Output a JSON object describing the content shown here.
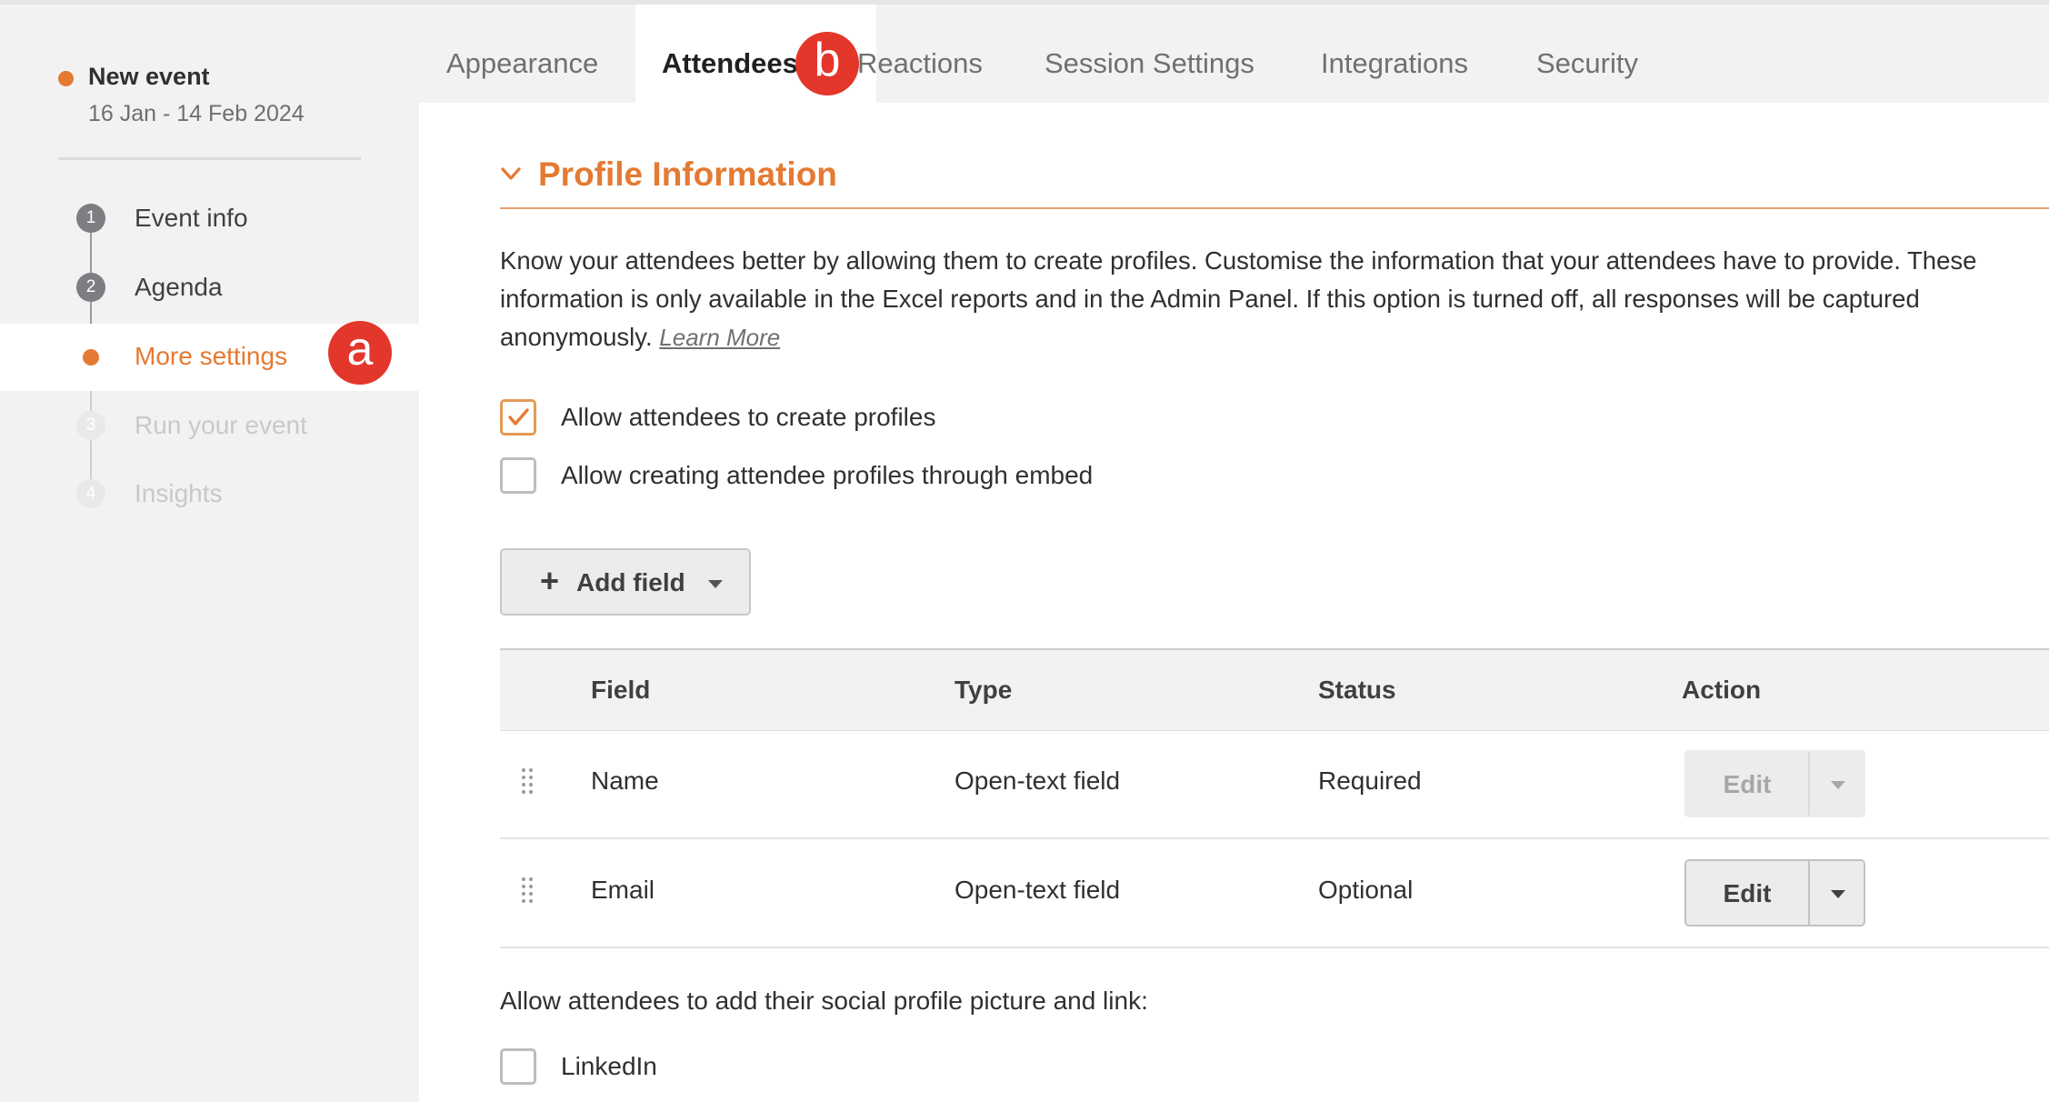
{
  "event": {
    "name": "New event",
    "dates": "16 Jan - 14 Feb 2024"
  },
  "sidebar": {
    "steps": [
      {
        "number": "1",
        "label": "Event info",
        "state": "done"
      },
      {
        "number": "2",
        "label": "Agenda",
        "state": "done"
      },
      {
        "number": "",
        "label": "More settings",
        "state": "active"
      },
      {
        "number": "3",
        "label": "Run your event",
        "state": "disabled"
      },
      {
        "number": "4",
        "label": "Insights",
        "state": "disabled"
      }
    ]
  },
  "annotations": {
    "a": "a",
    "b": "b"
  },
  "tabs": [
    {
      "label": "Appearance",
      "active": false
    },
    {
      "label": "Attendees",
      "active": true
    },
    {
      "label": "Reactions",
      "active": false
    },
    {
      "label": "Session Settings",
      "active": false
    },
    {
      "label": "Integrations",
      "active": false
    },
    {
      "label": "Security",
      "active": false
    }
  ],
  "section": {
    "title": "Profile Information",
    "description": "Know your attendees better by allowing them to create profiles. Customise the information that your attendees have to provide. These information is only available in the Excel reports and in the Admin Panel. If this option is turned off, all responses will be captured anonymously.",
    "learn_more": "Learn More"
  },
  "options": {
    "create_profiles": {
      "label": "Allow attendees to create profiles",
      "checked": true
    },
    "embed_profiles": {
      "label": "Allow creating attendee profiles through embed",
      "checked": false
    }
  },
  "add_field": {
    "plus": "+",
    "label": "Add field"
  },
  "table": {
    "headers": [
      "Field",
      "Type",
      "Status",
      "Action"
    ],
    "rows": [
      {
        "field": "Name",
        "type": "Open-text field",
        "status": "Required",
        "action": "Edit",
        "action_enabled": false
      },
      {
        "field": "Email",
        "type": "Open-text field",
        "status": "Optional",
        "action": "Edit",
        "action_enabled": true
      }
    ]
  },
  "social": {
    "label": "Allow attendees to add their social profile picture and link:",
    "linkedin": {
      "label": "LinkedIn",
      "checked": false
    }
  },
  "colors": {
    "accent": "#e57a33",
    "badge": "#e3372b"
  },
  "icons": {
    "section_toggle": "chevron-down-icon",
    "checked": "checkmark-icon",
    "add": "plus-icon",
    "dropdown": "caret-down-icon",
    "row_handle": "drag-handle-icon"
  }
}
